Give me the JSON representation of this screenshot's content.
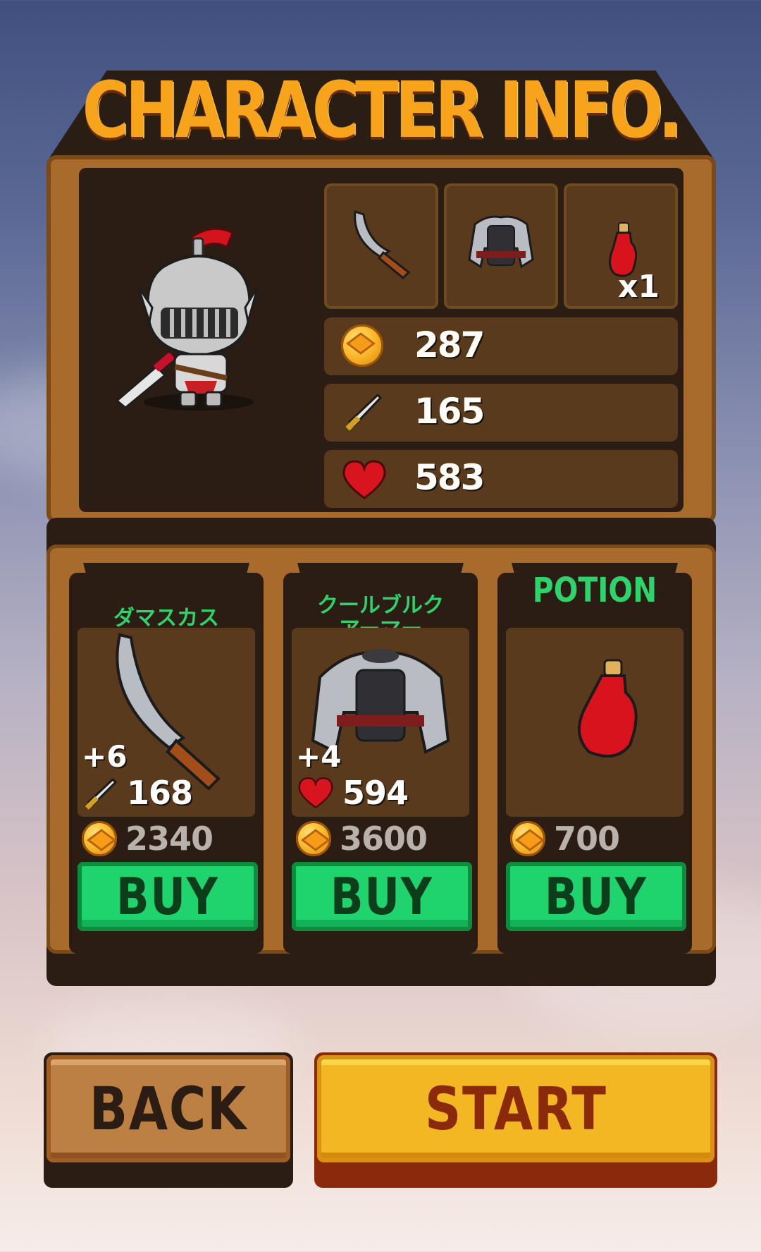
{
  "screen": {
    "title": "CHARACTER INFO.",
    "colors": {
      "accent_green": "#2ed36b",
      "title_orange": "#f7a31b",
      "panel_brown": "#a86b2c",
      "panel_dark": "#2b1d13"
    }
  },
  "equipment": {
    "slots": [
      {
        "icon": "scimitar-icon"
      },
      {
        "icon": "armor-icon"
      },
      {
        "icon": "potion-icon",
        "quantity": "x1"
      }
    ]
  },
  "stats": {
    "gold": "287",
    "attack": "165",
    "health": "583"
  },
  "shop": {
    "items": [
      {
        "name": "ダマスカス",
        "bonus": "+6",
        "stat_icon": "sword-icon",
        "stat_value": "168",
        "price": "2340",
        "buy_label": "BUY"
      },
      {
        "name": "クールブルク\nアーマー",
        "bonus": "+4",
        "stat_icon": "heart-icon",
        "stat_value": "594",
        "price": "3600",
        "buy_label": "BUY"
      },
      {
        "name": "POTION",
        "price": "700",
        "buy_label": "BUY"
      }
    ]
  },
  "actions": {
    "back_label": "BACK",
    "start_label": "START"
  }
}
